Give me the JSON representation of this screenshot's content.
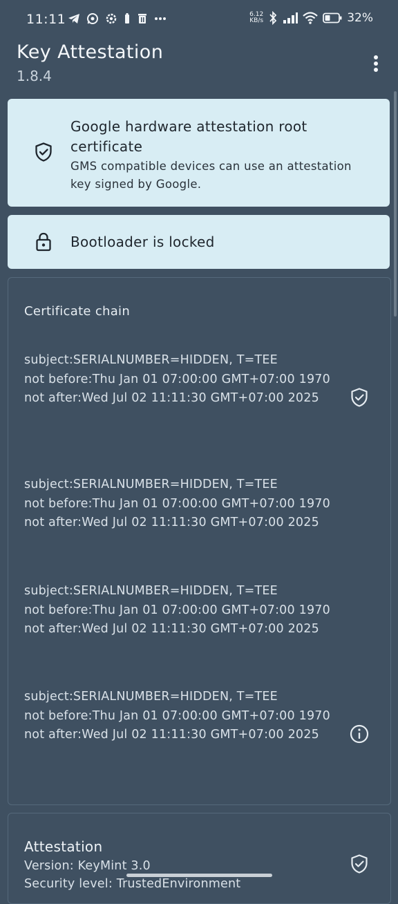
{
  "status_bar": {
    "time": "11:11",
    "left_icons": [
      "telegram-icon",
      "whatsapp-icon",
      "settings-icon",
      "battery-saver-icon",
      "trash-icon",
      "more-dots-icon"
    ],
    "net_speed_value": "6.12",
    "net_speed_unit": "KB/s",
    "battery_percent": "32%"
  },
  "app_bar": {
    "title": "Key Attestation",
    "version": "1.8.4"
  },
  "root_card": {
    "title": "Google hardware attestation root certificate",
    "subtitle": "GMS compatible devices can use an attestation key signed by Google."
  },
  "bootloader_card": {
    "text": "Bootloader is locked"
  },
  "certificate_chain": {
    "title": "Certificate chain",
    "certs": [
      {
        "subject": "subject:SERIALNUMBER=HIDDEN, T=TEE",
        "not_before": "not before:Thu Jan 01 07:00:00 GMT+07:00 1970",
        "not_after": "not after:Wed Jul 02 11:11:30 GMT+07:00 2025",
        "icon": "shield-check-icon"
      },
      {
        "subject": "subject:SERIALNUMBER=HIDDEN, T=TEE",
        "not_before": "not before:Thu Jan 01 07:00:00 GMT+07:00 1970",
        "not_after": "not after:Wed Jul 02 11:11:30 GMT+07:00 2025"
      },
      {
        "subject": "subject:SERIALNUMBER=HIDDEN, T=TEE",
        "not_before": "not before:Thu Jan 01 07:00:00 GMT+07:00 1970",
        "not_after": "not after:Wed Jul 02 11:11:30 GMT+07:00 2025"
      },
      {
        "subject": "subject:SERIALNUMBER=HIDDEN, T=TEE",
        "not_before": "not before:Thu Jan 01 07:00:00 GMT+07:00 1970",
        "not_after": "not after:Wed Jul 02 11:11:30 GMT+07:00 2025",
        "icon": "info-icon"
      }
    ]
  },
  "attestation": {
    "title": "Attestation",
    "version": "Version: KeyMint 3.0",
    "security_level": "Security level: TrustedEnvironment"
  }
}
